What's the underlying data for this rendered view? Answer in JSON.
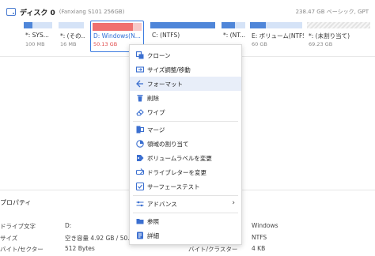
{
  "disk": {
    "name": "ディスク 0",
    "model": "(Fanxiang S101 256GB)",
    "info": "238.47 GB ベーシック, GPT"
  },
  "partitions": [
    {
      "label": "*: SYS...",
      "size": "100 MB",
      "fill": 0.3
    },
    {
      "label": "*: (その...",
      "size": "16 MB",
      "fill": 0.0
    },
    {
      "label": "D: Windows(N...",
      "size": "50.13 GB",
      "fill": 0.82
    },
    {
      "label": "C: (NTFS)",
      "size": "",
      "fill": 1.0
    },
    {
      "label": "*: (NT...",
      "size": "",
      "fill": 0.55
    },
    {
      "label": "E: ボリューム(NTFS",
      "size": "60 GB",
      "fill": 0.3
    },
    {
      "label": "*: (未割り当て)",
      "size": "69.23 GB",
      "fill": 0.0
    }
  ],
  "menu": {
    "items": [
      {
        "label": "クローン",
        "icon": "clone-icon"
      },
      {
        "label": "サイズ調整/移動",
        "icon": "resize-move-icon"
      },
      {
        "label": "フォーマット",
        "icon": "format-icon"
      },
      {
        "label": "削除",
        "icon": "delete-icon"
      },
      {
        "label": "ワイプ",
        "icon": "wipe-icon"
      },
      {
        "label": "マージ",
        "icon": "merge-icon"
      },
      {
        "label": "領域の割り当て",
        "icon": "allocate-space-icon"
      },
      {
        "label": "ボリュームラベルを変更",
        "icon": "volume-label-icon"
      },
      {
        "label": "ドライブレターを変更",
        "icon": "drive-letter-icon"
      },
      {
        "label": "サーフェーステスト",
        "icon": "surface-test-icon"
      },
      {
        "label": "アドバンス",
        "icon": "advanced-icon"
      },
      {
        "label": "参照",
        "icon": "browse-icon"
      },
      {
        "label": "詳細",
        "icon": "details-icon"
      }
    ]
  },
  "properties": {
    "title": "プロパティ",
    "rows": [
      {
        "k1": "ドライブ文字",
        "v1": "D:",
        "k2": "",
        "v2": "Windows"
      },
      {
        "k1": "サイズ",
        "v1": "空き容量 4.92 GB / 50.1",
        "k2": "",
        "v2": "NTFS"
      },
      {
        "k1": "バイト/セクター",
        "v1": "512 Bytes",
        "k2": "バイト/クラスター",
        "v2": "4 KB"
      }
    ]
  },
  "colors": {
    "accent": "#3b7be0",
    "used": "#4f86d9",
    "selected_used": "#f07070",
    "menu_hover": "#e8eef9"
  }
}
